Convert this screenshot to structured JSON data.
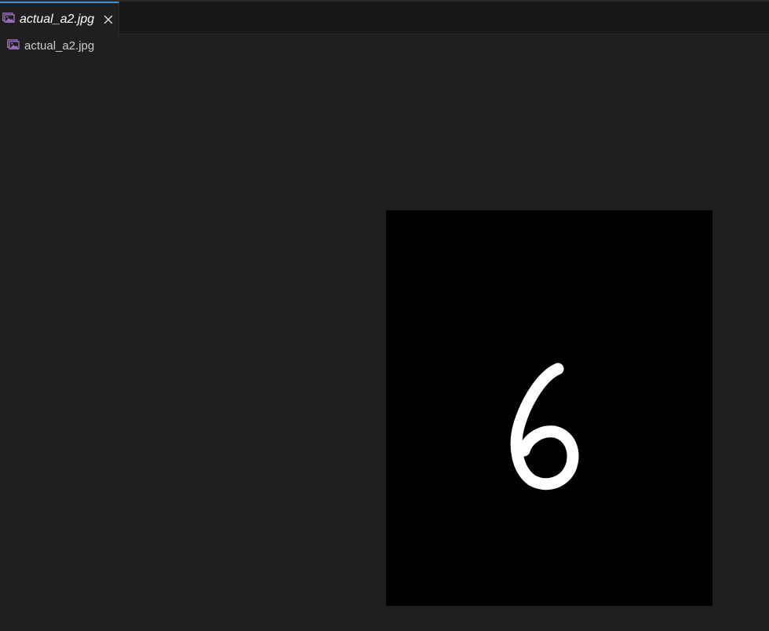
{
  "tabs": [
    {
      "label": "actual_a2.jpg",
      "icon": "image-file-icon",
      "active": true,
      "italic": true
    }
  ],
  "breadcrumb": {
    "label": "actual_a2.jpg",
    "icon": "image-file-icon"
  },
  "image_preview": {
    "depicted_digit": "6",
    "background_color": "#000000",
    "stroke_color": "#ffffff"
  },
  "colors": {
    "tabbar_bg": "#181818",
    "editor_bg": "#1f1f1f",
    "active_tab_accent": "#3f8fd8",
    "image_icon": "#a074c4"
  }
}
